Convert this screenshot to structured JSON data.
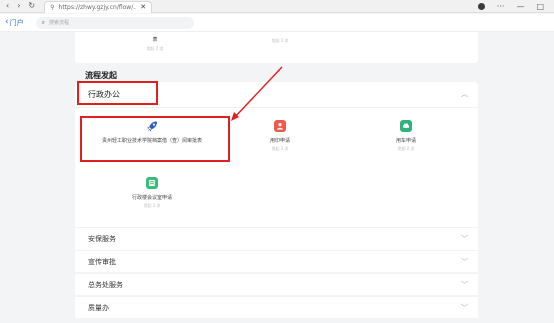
{
  "browser": {
    "nav_back": "‹",
    "nav_forward": "›",
    "nav_reload": "↻",
    "tab_url": "https://zhwy.gzjy.cn/flow/...",
    "tab_close": "✕",
    "more": "···",
    "minimize": "—",
    "maximize": "□"
  },
  "appbar": {
    "back_label": "门户",
    "search_placeholder": "搜索流程"
  },
  "previous_card": {
    "item1_title": "表",
    "item1_sub": "发起 2 次",
    "item2_sub": "发起 1 次"
  },
  "section_title": "流程发起",
  "admin_group": {
    "title": "行政办公",
    "apps": [
      {
        "name": "贵州轻工职业技术学院档案借（查）阅审批表",
        "sub": "发起 4 次",
        "color": "#2d5fb8",
        "icon": "rocket-icon"
      },
      {
        "name": "用印申请",
        "sub": "发起 3 次",
        "color": "#ee5a4a",
        "icon": "user-icon"
      },
      {
        "name": "用车申请",
        "sub": "发起 2 次",
        "color": "#2fb37a",
        "icon": "car-icon"
      },
      {
        "name": "行政楼会议室申请",
        "sub": "发起 1 次",
        "color": "#3cbb7a",
        "icon": "meeting-icon"
      }
    ]
  },
  "groups": [
    {
      "title": "安保服务"
    },
    {
      "title": "宣传审批"
    },
    {
      "title": "总务处服务"
    },
    {
      "title": "质量办"
    }
  ],
  "colors": {
    "accent": "#2f6fd6",
    "annotation": "#e02020"
  }
}
